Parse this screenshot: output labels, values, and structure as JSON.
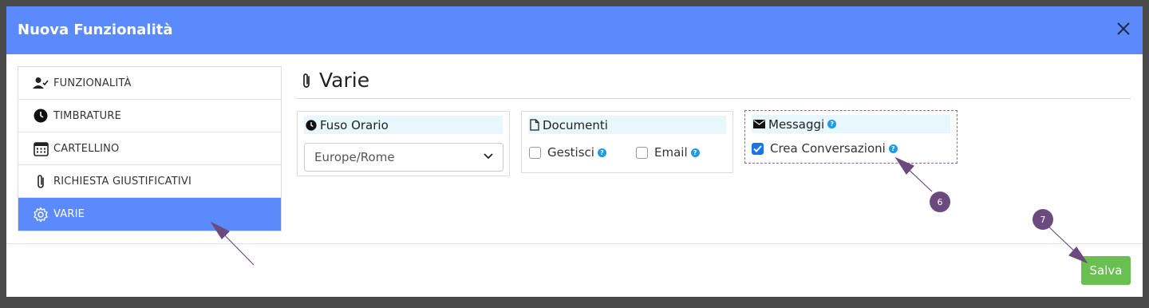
{
  "modal": {
    "title": "Nuova Funzionalità"
  },
  "sidebar": {
    "items": [
      {
        "label": "FUNZIONALITÀ",
        "icon": "user-check-icon"
      },
      {
        "label": "TIMBRATURE",
        "icon": "clock-icon"
      },
      {
        "label": "CARTELLINO",
        "icon": "calendar-icon"
      },
      {
        "label": "RICHIESTA GIUSTIFICATIVI",
        "icon": "paperclip-icon"
      },
      {
        "label": "VARIE",
        "icon": "gear-icon",
        "active": true
      }
    ]
  },
  "main": {
    "section_title": "Varie",
    "fuso_orario": {
      "title": "Fuso Orario",
      "selected": "Europe/Rome"
    },
    "documenti": {
      "title": "Documenti",
      "options": [
        {
          "label": "Gestisci",
          "checked": false
        },
        {
          "label": "Email",
          "checked": false
        }
      ]
    },
    "messaggi": {
      "title": "Messaggi",
      "options": [
        {
          "label": "Crea Conversazioni",
          "checked": true
        }
      ]
    }
  },
  "annotations": {
    "badge_6": "6",
    "badge_7": "7"
  },
  "footer": {
    "save_label": "Salva"
  },
  "colors": {
    "header": "#5b8afc",
    "active_item": "#5b8afc",
    "save": "#69c050",
    "badge": "#6d4a7e",
    "help": "#1e9be6"
  }
}
